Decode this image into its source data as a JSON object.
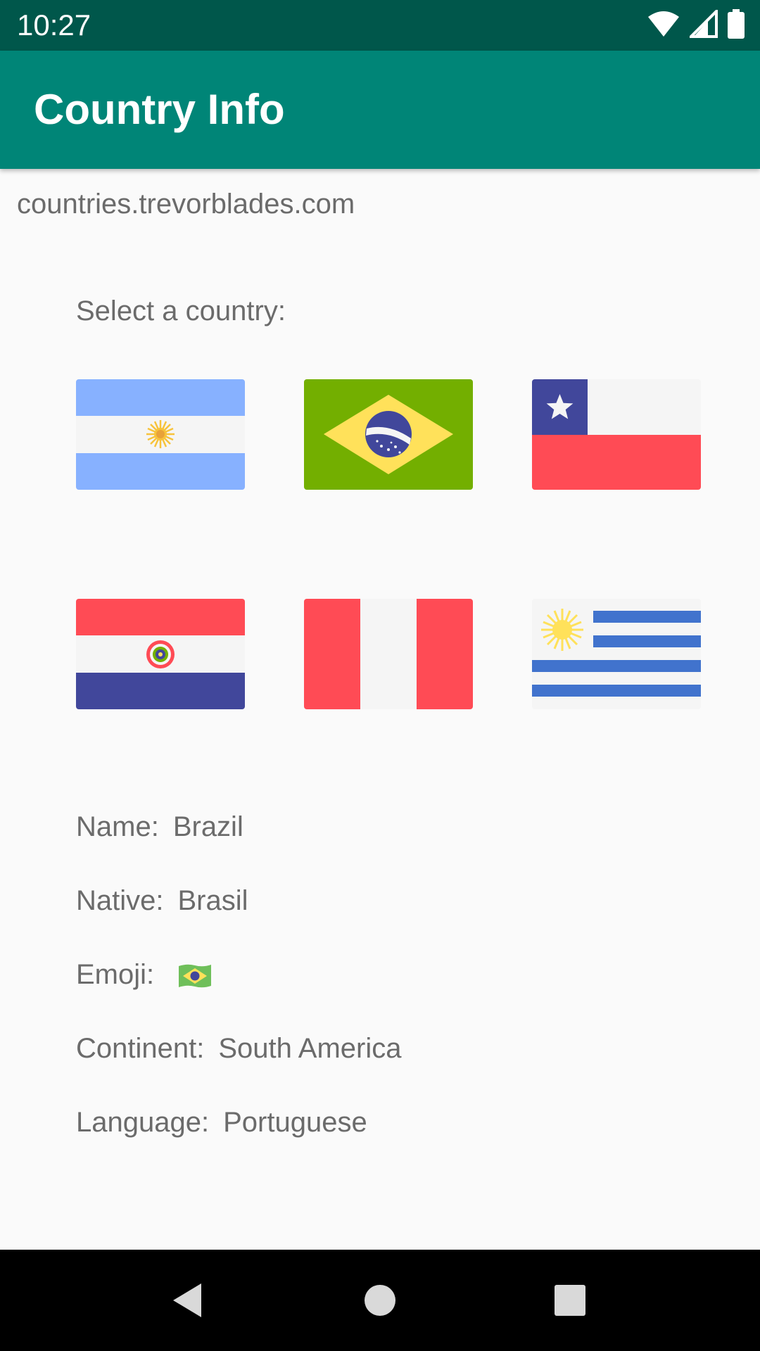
{
  "status_bar": {
    "time": "10:27",
    "icons": [
      "wifi-icon",
      "cell-signal-icon",
      "battery-icon"
    ]
  },
  "app_bar": {
    "title": "Country Info",
    "color": "#008577"
  },
  "source": {
    "url": "countries.trevorblades.com"
  },
  "selector": {
    "label": "Select a country:",
    "flags": [
      "argentina-flag",
      "brazil-flag",
      "chile-flag",
      "paraguay-flag",
      "peru-flag",
      "uruguay-flag"
    ]
  },
  "info": {
    "name_label": "Name:",
    "name_value": "Brazil",
    "native_label": "Native:",
    "native_value": "Brasil",
    "emoji_label": "Emoji:",
    "emoji_icon": "brazil-flag-emoji",
    "continent_label": "Continent:",
    "continent_value": "South America",
    "language_label": "Language:",
    "language_value": "Portuguese"
  },
  "nav_bar": {
    "buttons": [
      "back-button",
      "home-button",
      "recents-button"
    ]
  }
}
